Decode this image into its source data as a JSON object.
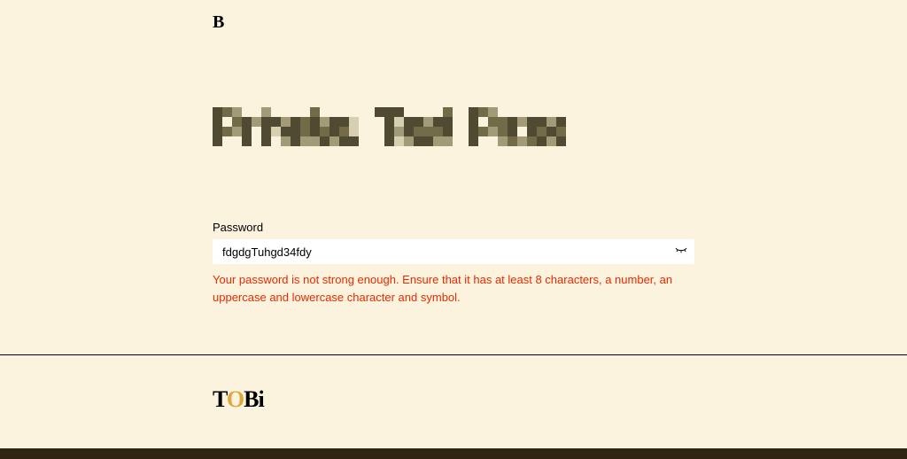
{
  "header": {
    "logo_text": "B"
  },
  "heading": {
    "obscured_text": "Private: Test Page"
  },
  "form": {
    "password": {
      "label": "Password",
      "value": "fdgdgTuhgd34fdy",
      "error": "Your password is not strong enough. Ensure that it has at least 8 characters, a number, an uppercase and lowercase character and symbol."
    }
  },
  "footer": {
    "logo_text": "TOBi"
  },
  "colors": {
    "background": "#fbf3de",
    "error": "#e82a00",
    "accent": "#e0a73f",
    "footer_bar": "#2e2411"
  }
}
